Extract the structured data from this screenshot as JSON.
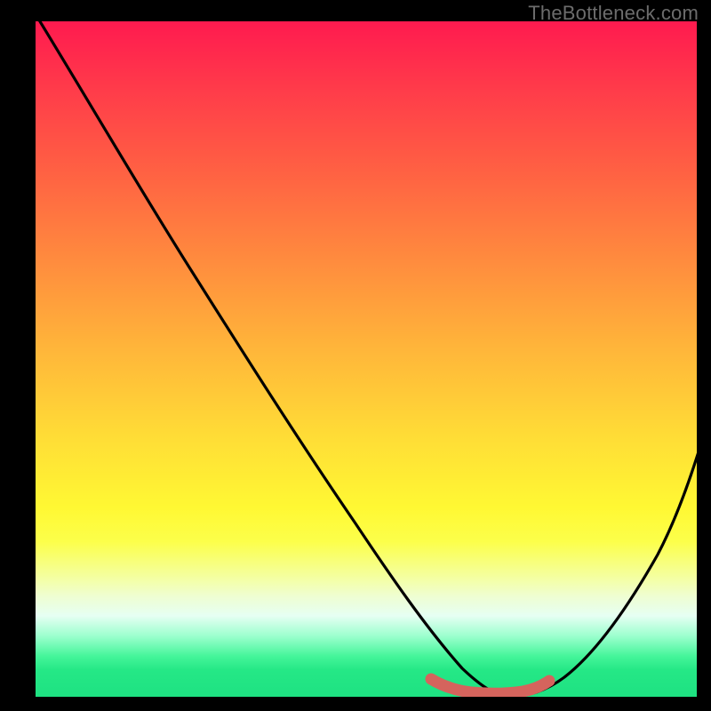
{
  "watermark": "TheBottleneck.com",
  "colors": {
    "background": "#000000",
    "curve_stroke": "#000000",
    "accent_stroke": "#d5645d",
    "gradient_top": "#ff1a4f",
    "gradient_bottom": "#1ee182"
  },
  "chart_data": {
    "type": "line",
    "title": "",
    "xlabel": "",
    "ylabel": "",
    "xlim": [
      0,
      100
    ],
    "ylim": [
      0,
      100
    ],
    "grid": false,
    "legend": false,
    "annotations": [
      {
        "text": "TheBottleneck.com",
        "position": "top-right"
      }
    ],
    "series": [
      {
        "name": "curve-left",
        "x": [
          0,
          5,
          10,
          15,
          20,
          25,
          30,
          35,
          40,
          45,
          50,
          55,
          60,
          63,
          66,
          70,
          72
        ],
        "values": [
          100,
          94,
          87,
          80,
          73,
          66,
          59,
          52,
          45,
          38,
          31,
          24,
          16,
          10,
          5,
          1,
          0
        ]
      },
      {
        "name": "curve-right",
        "x": [
          72,
          76,
          80,
          84,
          88,
          92,
          96,
          100
        ],
        "values": [
          0,
          3,
          8,
          14,
          21,
          29,
          38,
          47
        ]
      },
      {
        "name": "accent-bottom",
        "x": [
          60,
          63,
          66,
          70,
          72,
          74,
          76
        ],
        "values": [
          2,
          1,
          0.5,
          0.5,
          0.5,
          1,
          2
        ]
      }
    ]
  }
}
